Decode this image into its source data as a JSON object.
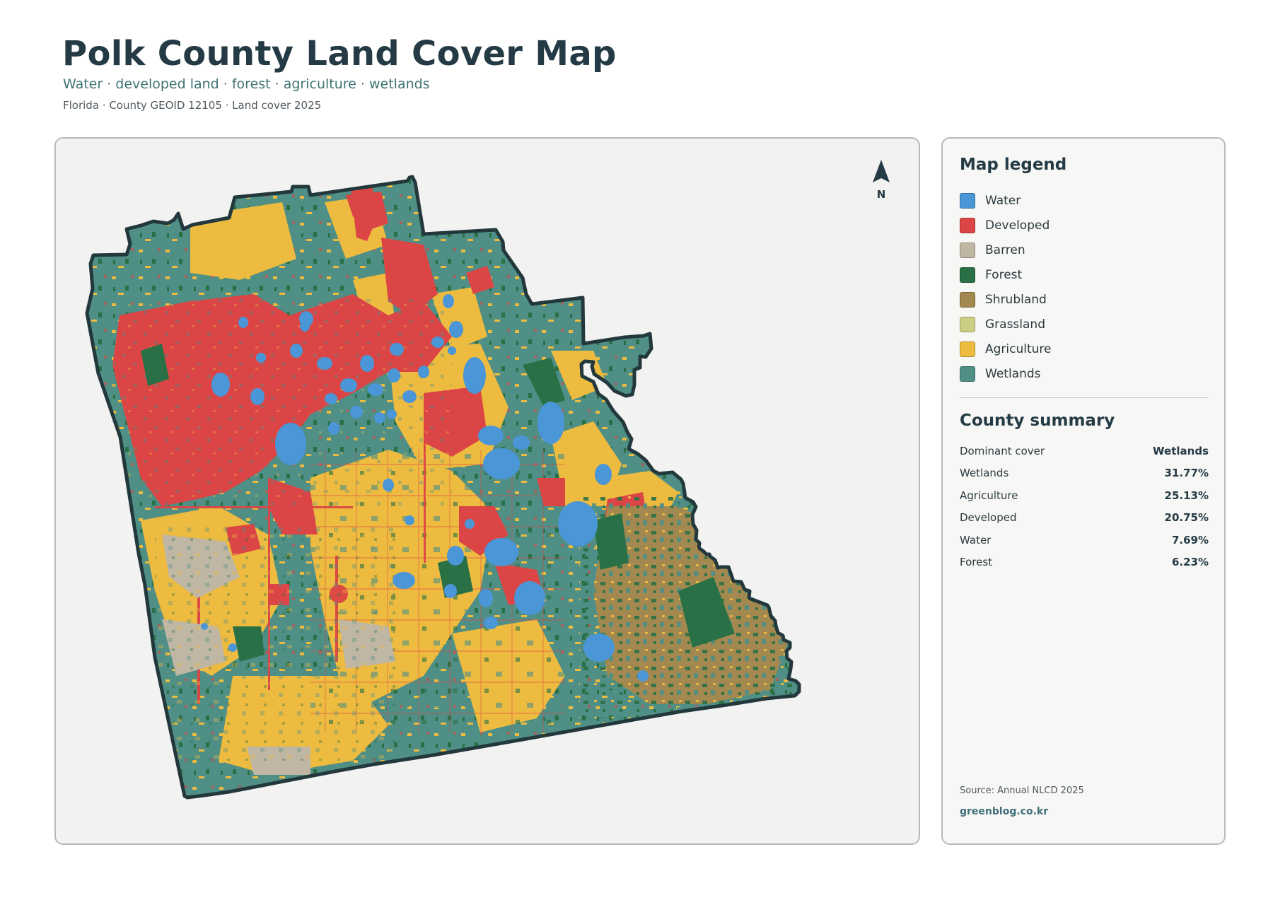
{
  "header": {
    "title": "Polk County Land Cover Map",
    "subtitle": "Water · developed land · forest · agriculture · wetlands",
    "meta": "Florida · County GEOID 12105 · Land cover 2025"
  },
  "map": {
    "north_label": "N",
    "colors": {
      "water": "#4a96d6",
      "developed": "#dc4545",
      "barren": "#bfb7a4",
      "forest": "#2a7046",
      "shrubland": "#a3894f",
      "grassland": "#cccf83",
      "agriculture": "#edbb3f",
      "wetlands": "#4f8f86",
      "outline": "#22383c"
    }
  },
  "legend": {
    "title": "Map legend",
    "items": [
      {
        "label": "Water",
        "color": "#4a96d6"
      },
      {
        "label": "Developed",
        "color": "#dc4545"
      },
      {
        "label": "Barren",
        "color": "#bfb7a4"
      },
      {
        "label": "Forest",
        "color": "#2a7046"
      },
      {
        "label": "Shrubland",
        "color": "#a3894f"
      },
      {
        "label": "Grassland",
        "color": "#cccf83"
      },
      {
        "label": "Agriculture",
        "color": "#edbb3f"
      },
      {
        "label": "Wetlands",
        "color": "#4f8f86"
      }
    ]
  },
  "summary": {
    "title": "County summary",
    "rows": [
      {
        "label": "Dominant cover",
        "value": "Wetlands"
      },
      {
        "label": "Wetlands",
        "value": "31.77%"
      },
      {
        "label": "Agriculture",
        "value": "25.13%"
      },
      {
        "label": "Developed",
        "value": "20.75%"
      },
      {
        "label": "Water",
        "value": "7.69%"
      },
      {
        "label": "Forest",
        "value": "6.23%"
      }
    ]
  },
  "footer": {
    "source": "Source: Annual NLCD 2025",
    "site": "greenblog.co.kr"
  }
}
